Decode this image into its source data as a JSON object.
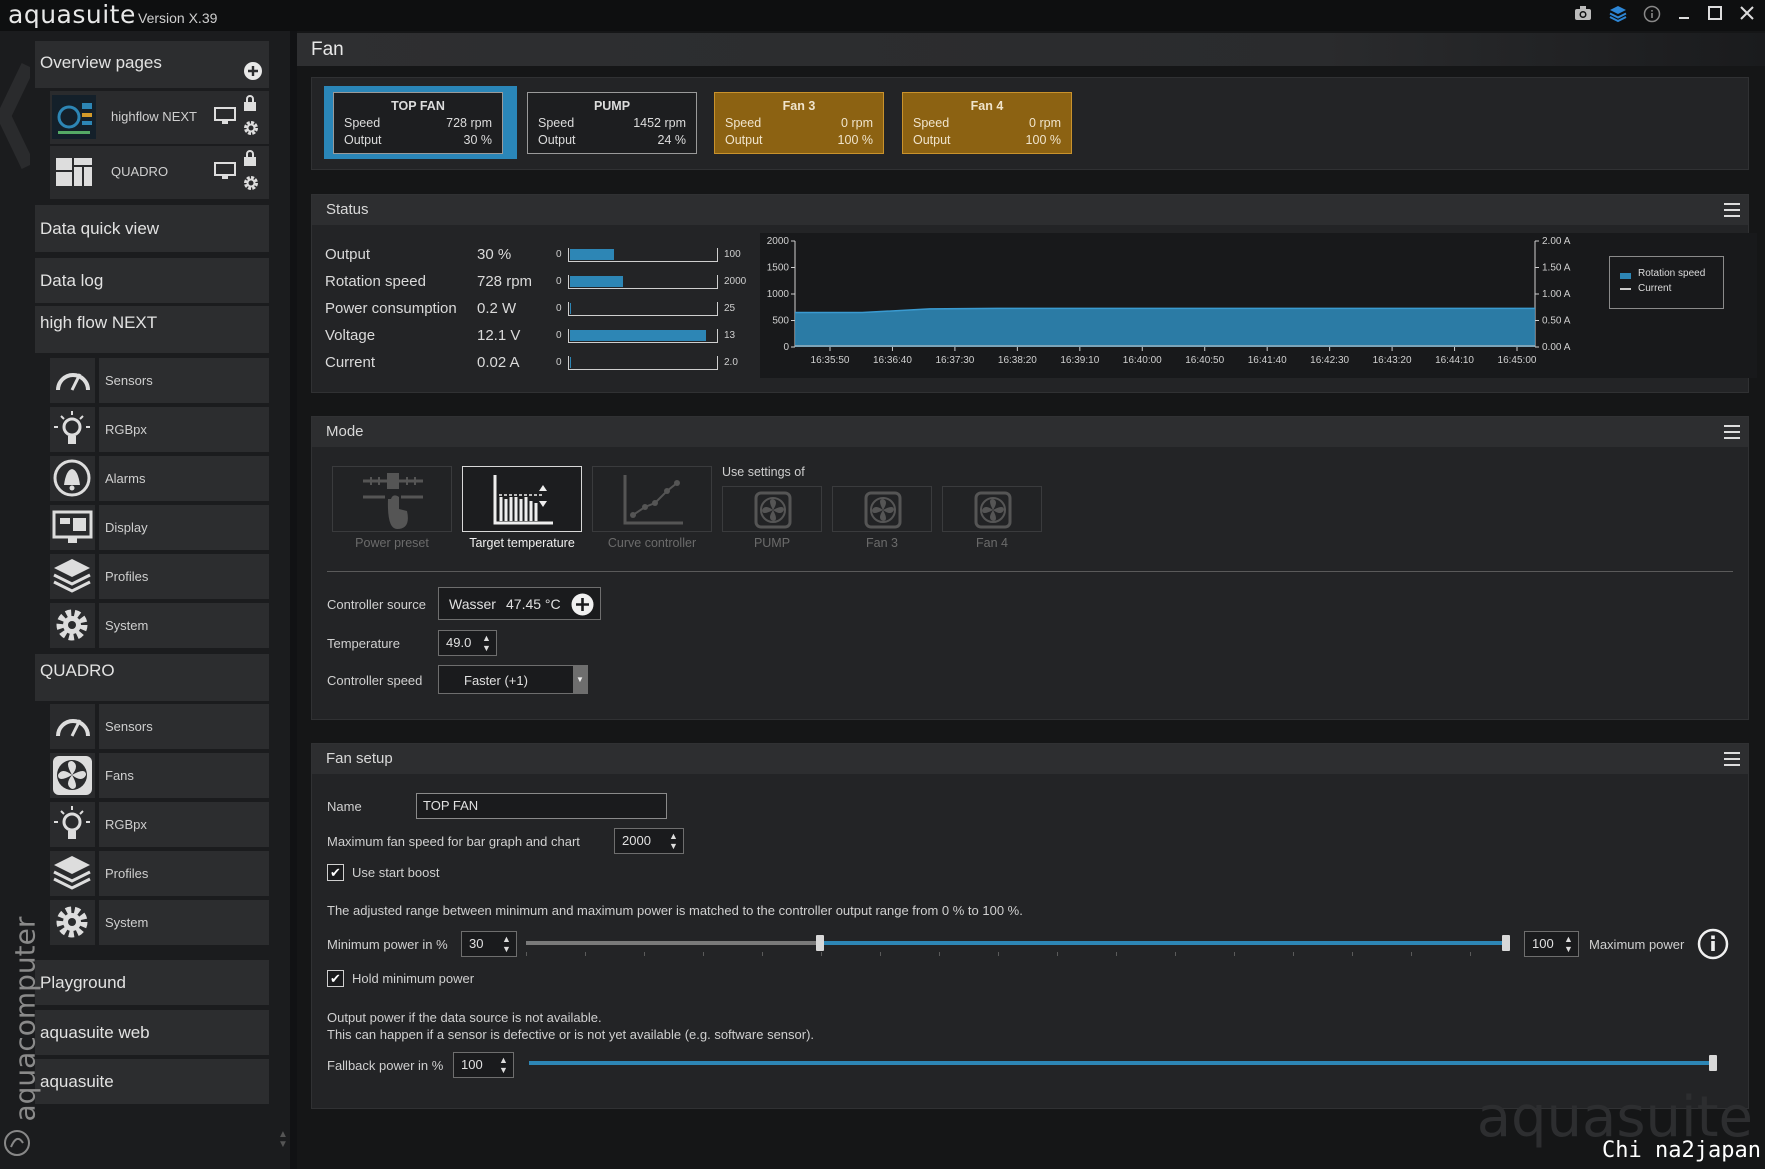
{
  "app": {
    "name": "aquasuite",
    "version": "Version X.39",
    "watermark_vertical": "aquacomputer",
    "watermark": "aquasuite",
    "credit": "Chi na2japan"
  },
  "titlebar_icons": [
    "camera-icon",
    "layers-icon",
    "info-icon",
    "minimize-icon",
    "maximize-icon",
    "close-icon"
  ],
  "sidebar": {
    "overview_title": "Overview pages",
    "pages": [
      {
        "label": "highflow NEXT"
      },
      {
        "label": "QUADRO"
      }
    ],
    "data_quick_view": "Data quick view",
    "data_log": "Data log",
    "highflow_title": "high flow NEXT",
    "highflow_items": [
      {
        "label": "Sensors"
      },
      {
        "label": "RGBpx"
      },
      {
        "label": "Alarms"
      },
      {
        "label": "Display"
      },
      {
        "label": "Profiles"
      },
      {
        "label": "System"
      }
    ],
    "quadro_title": "QUADRO",
    "quadro_items": [
      {
        "label": "Sensors"
      },
      {
        "label": "Fans"
      },
      {
        "label": "RGBpx"
      },
      {
        "label": "Profiles"
      },
      {
        "label": "System"
      }
    ],
    "playground": "Playground",
    "web": "aquasuite web",
    "aquasuite": "aquasuite"
  },
  "page_title": "Fan",
  "fan_tiles": [
    {
      "name": "TOP FAN",
      "speed_label": "Speed",
      "speed": "728 rpm",
      "output_label": "Output",
      "output": "30 %",
      "state": "selected"
    },
    {
      "name": "PUMP",
      "speed_label": "Speed",
      "speed": "1452 rpm",
      "output_label": "Output",
      "output": "24 %",
      "state": "normal"
    },
    {
      "name": "Fan 3",
      "speed_label": "Speed",
      "speed": "0 rpm",
      "output_label": "Output",
      "output": "100 %",
      "state": "warning"
    },
    {
      "name": "Fan 4",
      "speed_label": "Speed",
      "speed": "0 rpm",
      "output_label": "Output",
      "output": "100 %",
      "state": "warning"
    }
  ],
  "status": {
    "title": "Status",
    "rows": [
      {
        "label": "Output",
        "value": "30 %",
        "min": "0",
        "max": "100",
        "fill": 0.3
      },
      {
        "label": "Rotation speed",
        "value": "728 rpm",
        "min": "0",
        "max": "2000",
        "fill": 0.364
      },
      {
        "label": "Power consumption",
        "value": "0.2 W",
        "min": "0",
        "max": "25",
        "fill": 0.008
      },
      {
        "label": "Voltage",
        "value": "12.1 V",
        "min": "0",
        "max": "13",
        "fill": 0.93
      },
      {
        "label": "Current",
        "value": "0.02 A",
        "min": "0",
        "max": "2.0",
        "fill": 0.01
      }
    ]
  },
  "chart_data": {
    "type": "area",
    "x": [
      "16:35:50",
      "16:36:40",
      "16:37:30",
      "16:38:20",
      "16:39:10",
      "16:40:00",
      "16:40:50",
      "16:41:40",
      "16:42:30",
      "16:43:20",
      "16:44:10",
      "16:45:00"
    ],
    "x_ticks": [
      "16:35:50",
      "16:36:40",
      "16:37:30",
      "16:38:20",
      "16:39:10",
      "16:40:00",
      "16:40:50",
      "16:41:40",
      "16:42:30",
      "16:43:20",
      "16:44:10",
      "16:45:00"
    ],
    "y_ticks": [
      "0",
      "500",
      "1000",
      "1500",
      "2000"
    ],
    "y2_ticks": [
      "0.00 A",
      "0.50 A",
      "1.00 A",
      "1.50 A",
      "2.00 A"
    ],
    "ylim": [
      0,
      2000
    ],
    "y2lim": [
      0,
      2.0
    ],
    "series": [
      {
        "name": "Rotation speed",
        "color": "#2d86b5",
        "values": [
          650,
          650,
          720,
          728,
          728,
          728,
          728,
          728,
          728,
          728,
          728,
          728
        ]
      },
      {
        "name": "Current",
        "color": "#cccccc",
        "values": [
          0.02,
          0.02,
          0.02,
          0.02,
          0.02,
          0.02,
          0.02,
          0.02,
          0.02,
          0.02,
          0.02,
          0.02
        ]
      }
    ],
    "legend_position": "top-right"
  },
  "mode": {
    "title": "Mode",
    "buttons": [
      {
        "label": "Power preset"
      },
      {
        "label": "Target temperature"
      },
      {
        "label": "Curve controller"
      }
    ],
    "use_settings_label": "Use settings of",
    "settings_buttons": [
      {
        "label": "PUMP"
      },
      {
        "label": "Fan 3"
      },
      {
        "label": "Fan 4"
      }
    ],
    "controller_source_label": "Controller source",
    "controller_source_value": "Wasser",
    "controller_source_temp": "47.45 °C",
    "temperature_label": "Temperature",
    "temperature_value": "49.0",
    "controller_speed_label": "Controller speed",
    "controller_speed_value": "Faster (+1)"
  },
  "fan_setup": {
    "title": "Fan setup",
    "name_label": "Name",
    "name_value": "TOP FAN",
    "max_speed_label": "Maximum fan speed for bar graph and chart",
    "max_speed_value": "2000",
    "start_boost_label": "Use start boost",
    "range_info": "The adjusted range between minimum and maximum power is matched to the controller output range from 0 % to 100 %.",
    "min_power_label": "Minimum power in %",
    "min_power_value": "30",
    "max_power_value": "100",
    "max_power_label": "Maximum power",
    "hold_min_label": "Hold minimum power",
    "fallback_info1": "Output power if the data source is not available.",
    "fallback_info2": "This can happen if a sensor is defective or is not yet available (e.g. software sensor).",
    "fallback_label": "Fallback power in %",
    "fallback_value": "100"
  }
}
